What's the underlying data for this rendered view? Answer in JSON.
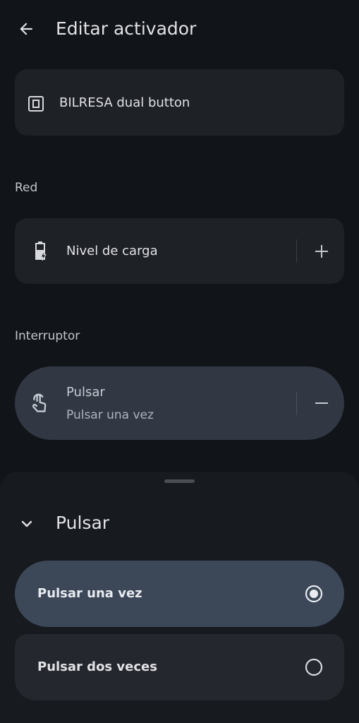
{
  "header": {
    "title": "Editar activador",
    "back_icon": "arrow-back-icon"
  },
  "device": {
    "name": "BILRESA dual button",
    "icon": "device-square-icon"
  },
  "sections": {
    "network_label": "Red",
    "switch_label": "Interruptor"
  },
  "battery": {
    "label": "Nivel de carga",
    "icon": "battery-charging-icon",
    "action_icon": "plus-icon"
  },
  "press": {
    "title": "Pulsar",
    "subtitle": "Pulsar una vez",
    "icon": "touch-hand-icon",
    "action_icon": "minus-icon"
  },
  "sheet": {
    "title": "Pulsar",
    "collapse_icon": "chevron-down-icon",
    "options": [
      {
        "label": "Pulsar una vez",
        "selected": true
      },
      {
        "label": "Pulsar dos veces",
        "selected": false
      }
    ]
  },
  "colors": {
    "background": "#111418",
    "card": "#1e2126",
    "selected_card": "#313844",
    "selected_option": "#3c4758",
    "text": "#e2e2e6"
  }
}
